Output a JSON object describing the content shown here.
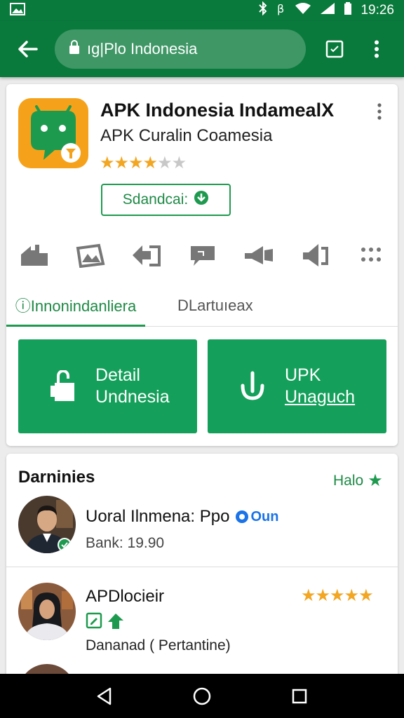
{
  "status_bar": {
    "time": "19:26",
    "icons": [
      "image-icon",
      "bluetooth-icon",
      "data-icon",
      "wifi-icon",
      "signal-icon",
      "battery-icon"
    ]
  },
  "toolbar": {
    "url": "ıg|Plo Indonesia",
    "icons": [
      "back-arrow-icon",
      "lock-icon",
      "tab-icon",
      "more-vert-icon"
    ]
  },
  "app": {
    "title": "APK Indonesia IndamealX",
    "subtitle": "APK Curalin Coamesia",
    "rating": 4,
    "rating_max": 6,
    "stars_text_on": "★★★★",
    "stars_text_off": "★★",
    "primary_button": "Sdandcai:"
  },
  "feature_icons": [
    "home-icon",
    "gallery-icon",
    "share-icon",
    "chat-icon",
    "speaker-icon",
    "volume-icon",
    "grid-icon"
  ],
  "tabs": [
    {
      "label": "ⓘInnonindanliera",
      "active": true
    },
    {
      "label": "DLartuıeax",
      "active": false
    }
  ],
  "actions": [
    {
      "line1": "Detail",
      "line2": "Undnesia",
      "icon": "bag-icon"
    },
    {
      "line1": "UPK",
      "line2": "Unaguch",
      "icon": "download-icon"
    }
  ],
  "reviews_section": {
    "header": "Darninies",
    "link": "Halo",
    "reviews": [
      {
        "name": "Uoral Ilnmena: Ppo",
        "badge": "Oun",
        "meta": "Bank: 19.90"
      },
      {
        "name": "APDlocieir",
        "stars_text": "★★★★★",
        "text": "Dananad ( Pertantine)"
      }
    ]
  },
  "colors": {
    "primary": "#0a7a3c",
    "accent": "#14a05a",
    "star": "#f2a622",
    "star_green": "#1e9a4f",
    "link": "#1a73e8"
  },
  "nav_bar": {
    "icons": [
      "back-triangle-icon",
      "home-circle-icon",
      "recents-square-icon"
    ]
  }
}
